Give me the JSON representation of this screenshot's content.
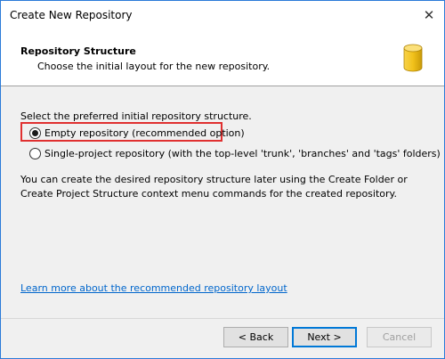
{
  "window": {
    "title": "Create New Repository",
    "close_glyph": "✕"
  },
  "header": {
    "title": "Repository Structure",
    "subtitle": "Choose the initial layout for the new repository.",
    "icon": "database-icon"
  },
  "content": {
    "prompt": "Select the preferred initial repository structure.",
    "options": [
      {
        "label": "Empty repository (recommended option)",
        "checked": true
      },
      {
        "label": "Single-project repository (with the top-level 'trunk', 'branches' and 'tags' folders)",
        "checked": false
      }
    ],
    "info": "You can create the desired repository structure later using the Create Folder or Create Project Structure context menu commands for the created repository.",
    "learn_link": "Learn more about the recommended repository layout"
  },
  "buttons": {
    "back": "< Back",
    "next": "Next >",
    "cancel": "Cancel"
  },
  "colors": {
    "accent": "#0078d7",
    "highlight": "#e03030",
    "link": "#0066cc",
    "icon_yellow": "#f2c21b"
  }
}
